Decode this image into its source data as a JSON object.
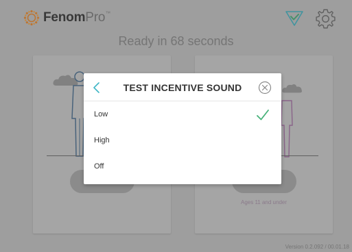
{
  "app": {
    "brand_bold": "Fenom",
    "brand_light": "Pro",
    "brand_tm": "™"
  },
  "header": {
    "status_icon": "checkmark-triangle-icon",
    "settings_icon": "gear-icon"
  },
  "status": {
    "ready_text": "Ready in 68 seconds"
  },
  "cards": {
    "right_note": "Ages 11 and under"
  },
  "footer": {
    "version": "Version 0.2.092 / 00.01.18"
  },
  "modal": {
    "title": "TEST INCENTIVE SOUND",
    "back_icon": "chevron-left-icon",
    "close_icon": "close-circle-icon",
    "options": [
      {
        "label": "Low",
        "selected": true
      },
      {
        "label": "High",
        "selected": false
      },
      {
        "label": "Off",
        "selected": false
      }
    ]
  },
  "colors": {
    "accent": "#2ab5a0",
    "teal_icon": "#3fb6c6",
    "check": "#47b27a"
  }
}
